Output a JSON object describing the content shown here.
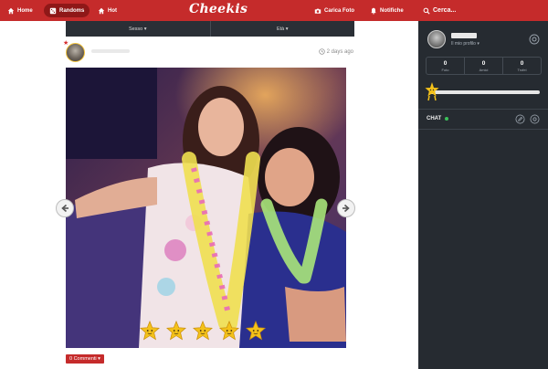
{
  "topbar": {
    "home": "Home",
    "randoms": "Randoms",
    "hot": "Hot",
    "logo": "Cheekis",
    "upload": "Carica Foto",
    "notifications": "Notifiche",
    "search": "Cerca..."
  },
  "filters": {
    "sex": "Sesso ▾",
    "age": "Età ▾"
  },
  "post": {
    "time": "2 days ago",
    "rating_stars": 5,
    "comments_button": "0 Commenti ▾"
  },
  "sidebar": {
    "profile_link": "Il mio profilo ▾",
    "stats": [
      {
        "value": "0",
        "label": "Foto"
      },
      {
        "value": "0",
        "label": "Amici"
      },
      {
        "value": "0",
        "label": "Trofei"
      }
    ],
    "level_progress": 0.02,
    "chat_label": "CHAT"
  },
  "colors": {
    "brand_red": "#c52b2b",
    "sidebar_bg": "#262b31",
    "online_green": "#3bc05a",
    "star_yellow": "#f4c21a"
  }
}
